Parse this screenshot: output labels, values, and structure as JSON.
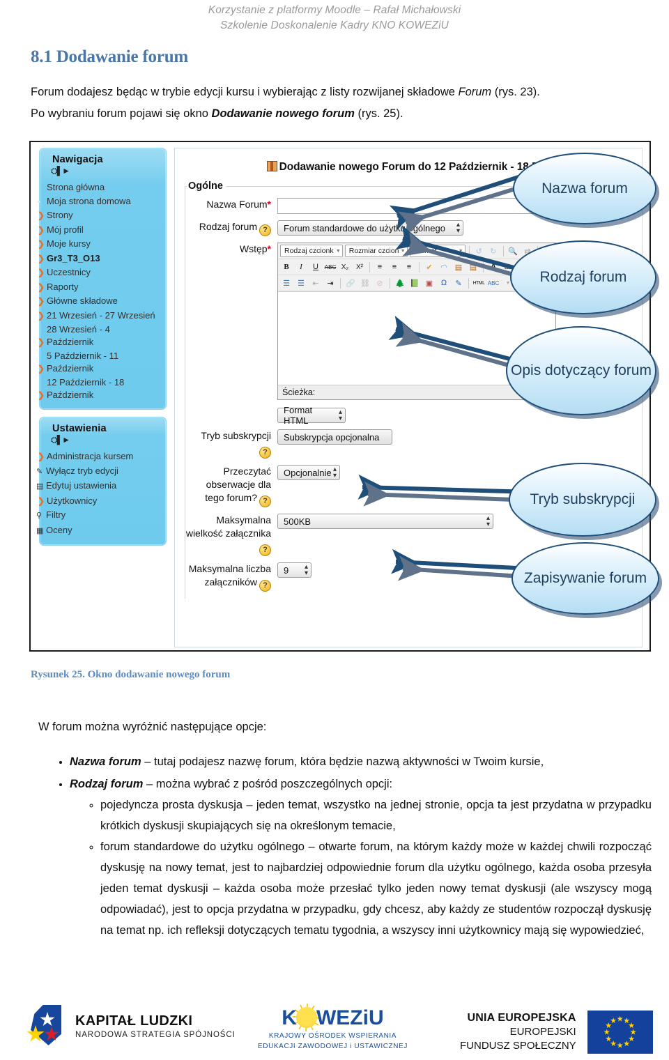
{
  "header": {
    "line1": "Korzystanie z platformy Moodle – Rafał Michałowski",
    "line2": "Szkolenie Doskonalenie Kadry KNO KOWEZiU"
  },
  "section": {
    "heading": "8.1 Dodawanie forum",
    "intro_1a": "Forum dodajesz będąc w trybie edycji kursu i wybierając z listy rozwijanej składowe ",
    "intro_1b": "Forum",
    "intro_1c": " (rys. 23).",
    "intro_2a": "Po wybraniu forum pojawi się okno ",
    "intro_2b": "Dodawanie nowego forum",
    "intro_2c": " (rys. 25)."
  },
  "screenshot": {
    "nav_block": {
      "title": "Nawigacja",
      "items": [
        {
          "label": "Strona główna",
          "indent": 0,
          "marker": "none",
          "bold": false
        },
        {
          "label": "Moja strona domowa",
          "indent": 1,
          "marker": "dot",
          "bold": false
        },
        {
          "label": "Strony",
          "indent": 1,
          "marker": "chevron",
          "bold": false
        },
        {
          "label": "Mój profil",
          "indent": 1,
          "marker": "chevron",
          "bold": false
        },
        {
          "label": "Moje kursy",
          "indent": 1,
          "marker": "chevron-down",
          "bold": false
        },
        {
          "label": "Gr3_T3_O13",
          "indent": 2,
          "marker": "chevron-down",
          "bold": true
        },
        {
          "label": "Uczestnicy",
          "indent": 3,
          "marker": "chevron",
          "bold": false
        },
        {
          "label": "Raporty",
          "indent": 3,
          "marker": "chevron",
          "bold": false
        },
        {
          "label": "Główne składowe",
          "indent": 3,
          "marker": "chevron",
          "bold": false
        },
        {
          "label": "21 Wrzesień - 27 Wrzesień",
          "indent": 3,
          "marker": "chevron",
          "bold": false
        },
        {
          "label": "28 Wrzesień - 4 Październik",
          "indent": 3,
          "marker": "chevron",
          "bold": false
        },
        {
          "label": "5 Październik - 11 Październik",
          "indent": 3,
          "marker": "chevron",
          "bold": false
        },
        {
          "label": "12 Październik - 18 Październik",
          "indent": 3,
          "marker": "chevron",
          "bold": false
        }
      ]
    },
    "settings_block": {
      "title": "Ustawienia",
      "items": [
        {
          "label": "Administracja kursem",
          "indent": 1,
          "marker": "chevron-down",
          "icon": ""
        },
        {
          "label": "Wyłącz tryb edycji",
          "indent": 2,
          "marker": "icon",
          "icon": "✎"
        },
        {
          "label": "Edytuj ustawienia",
          "indent": 2,
          "marker": "icon",
          "icon": "▤"
        },
        {
          "label": "Użytkownicy",
          "indent": 2,
          "marker": "chevron",
          "icon": ""
        },
        {
          "label": "Filtry",
          "indent": 2,
          "marker": "icon",
          "icon": "⚲"
        },
        {
          "label": "Oceny",
          "indent": 2,
          "marker": "icon",
          "icon": "▦"
        }
      ]
    },
    "form": {
      "title": "Dodawanie nowego Forum do 12 Październik - 18 Paź",
      "legend": "Ogólne",
      "name_label": "Nazwa Forum",
      "name_value": "",
      "type_label": "Rodzaj forum",
      "type_value": "Forum standardowe do użytku ogólnego",
      "intro_label": "Wstęp",
      "editor": {
        "font_family": "Rodzaj czcionk",
        "font_size": "Rozmiar czcion",
        "format": "Format",
        "path_label": "Ścieżka:",
        "row2": [
          "B",
          "I",
          "U",
          "ABC",
          "X₂",
          "X²",
          "≡",
          "≡",
          "≡",
          "✔",
          "✂",
          "⬛",
          "⬛",
          "A",
          "ab"
        ],
        "row3": [
          "⋮≡",
          "⒈≡",
          "⇤",
          "⇥",
          "🔗",
          "⛓",
          "⊘",
          "🌳",
          "📕",
          "▣",
          "Ω",
          "✍",
          "HTML",
          "ABC"
        ]
      },
      "format_select": "Format HTML",
      "sub_label": "Tryb subskrypcji",
      "sub_value": "Subskrypcja opcjonalna",
      "read_label": "Przeczytać obserwacje dla tego forum?",
      "read_value": "Opcjonalnie",
      "maxsize_label": "Maksymalna wielkość załącznika",
      "maxsize_value": "500KB",
      "maxcount_label": "Maksymalna liczba załączników",
      "maxcount_value": "9"
    },
    "callouts": [
      {
        "label": "Nazwa forum"
      },
      {
        "label": "Rodzaj forum"
      },
      {
        "label": "Opis dotyczący forum"
      },
      {
        "label": "Tryb subskrypcji"
      },
      {
        "label": "Zapisywanie forum"
      }
    ]
  },
  "caption": "Rysunek 25. Okno dodawanie nowego forum",
  "body": {
    "lead": "W forum można wyróżnić następujące opcje:",
    "b1_term": "Nazwa forum",
    "b1_rest": " – tutaj podajesz nazwę forum, która będzie nazwą aktywności w Twoim kursie,",
    "b2_term": "Rodzaj forum",
    "b2_rest": " – można wybrać z pośród poszczególnych opcji:",
    "s1": "pojedyncza prosta dyskusja – jeden temat, wszystko na jednej stronie, opcja ta jest przydatna w przypadku krótkich dyskusji skupiających się na określonym temacie,",
    "s2": "forum standardowe do użytku ogólnego – otwarte forum, na którym każdy może w każdej chwili  rozpocząć dyskusję na nowy temat, jest to najbardziej odpowiednie forum dla użytku  ogólnego, każda osoba przesyła jeden temat dyskusji – każda osoba może przesłać tylko jeden nowy temat dyskusji (ale wszyscy mogą odpowiadać), jest to opcja przydatna w przypadku, gdy chcesz, aby każdy ze studentów rozpoczął dyskusję na temat np. ich refleksji dotyczących tematu tygodnia, a wszyscy inni użytkownicy mają się wypowiedzieć,"
  },
  "footer": {
    "kapital_title": "KAPITAŁ LUDZKI",
    "kapital_sub": "NARODOWA STRATEGIA SPÓJNOŚCI",
    "kowe_pre": "K",
    "kowe_post": "WEZiU",
    "kowe_sub1": "KRAJOWY OŚRODEK WSPIERANIA",
    "kowe_sub2": "EDUKACJI ZAWODOWEJ i USTAWICZNEJ",
    "eu_l1": "UNIA EUROPEJSKA",
    "eu_l2": "EUROPEJSKI",
    "eu_l3": "FUNDUSZ SPOŁECZNY"
  },
  "colors": {
    "heading": "#4a77a8",
    "caption": "#5b8cc0",
    "bubble_border": "#1f4e79",
    "arrow": "#1f4e79",
    "sidebar": "#74cdee",
    "chevron": "#e8722a"
  }
}
